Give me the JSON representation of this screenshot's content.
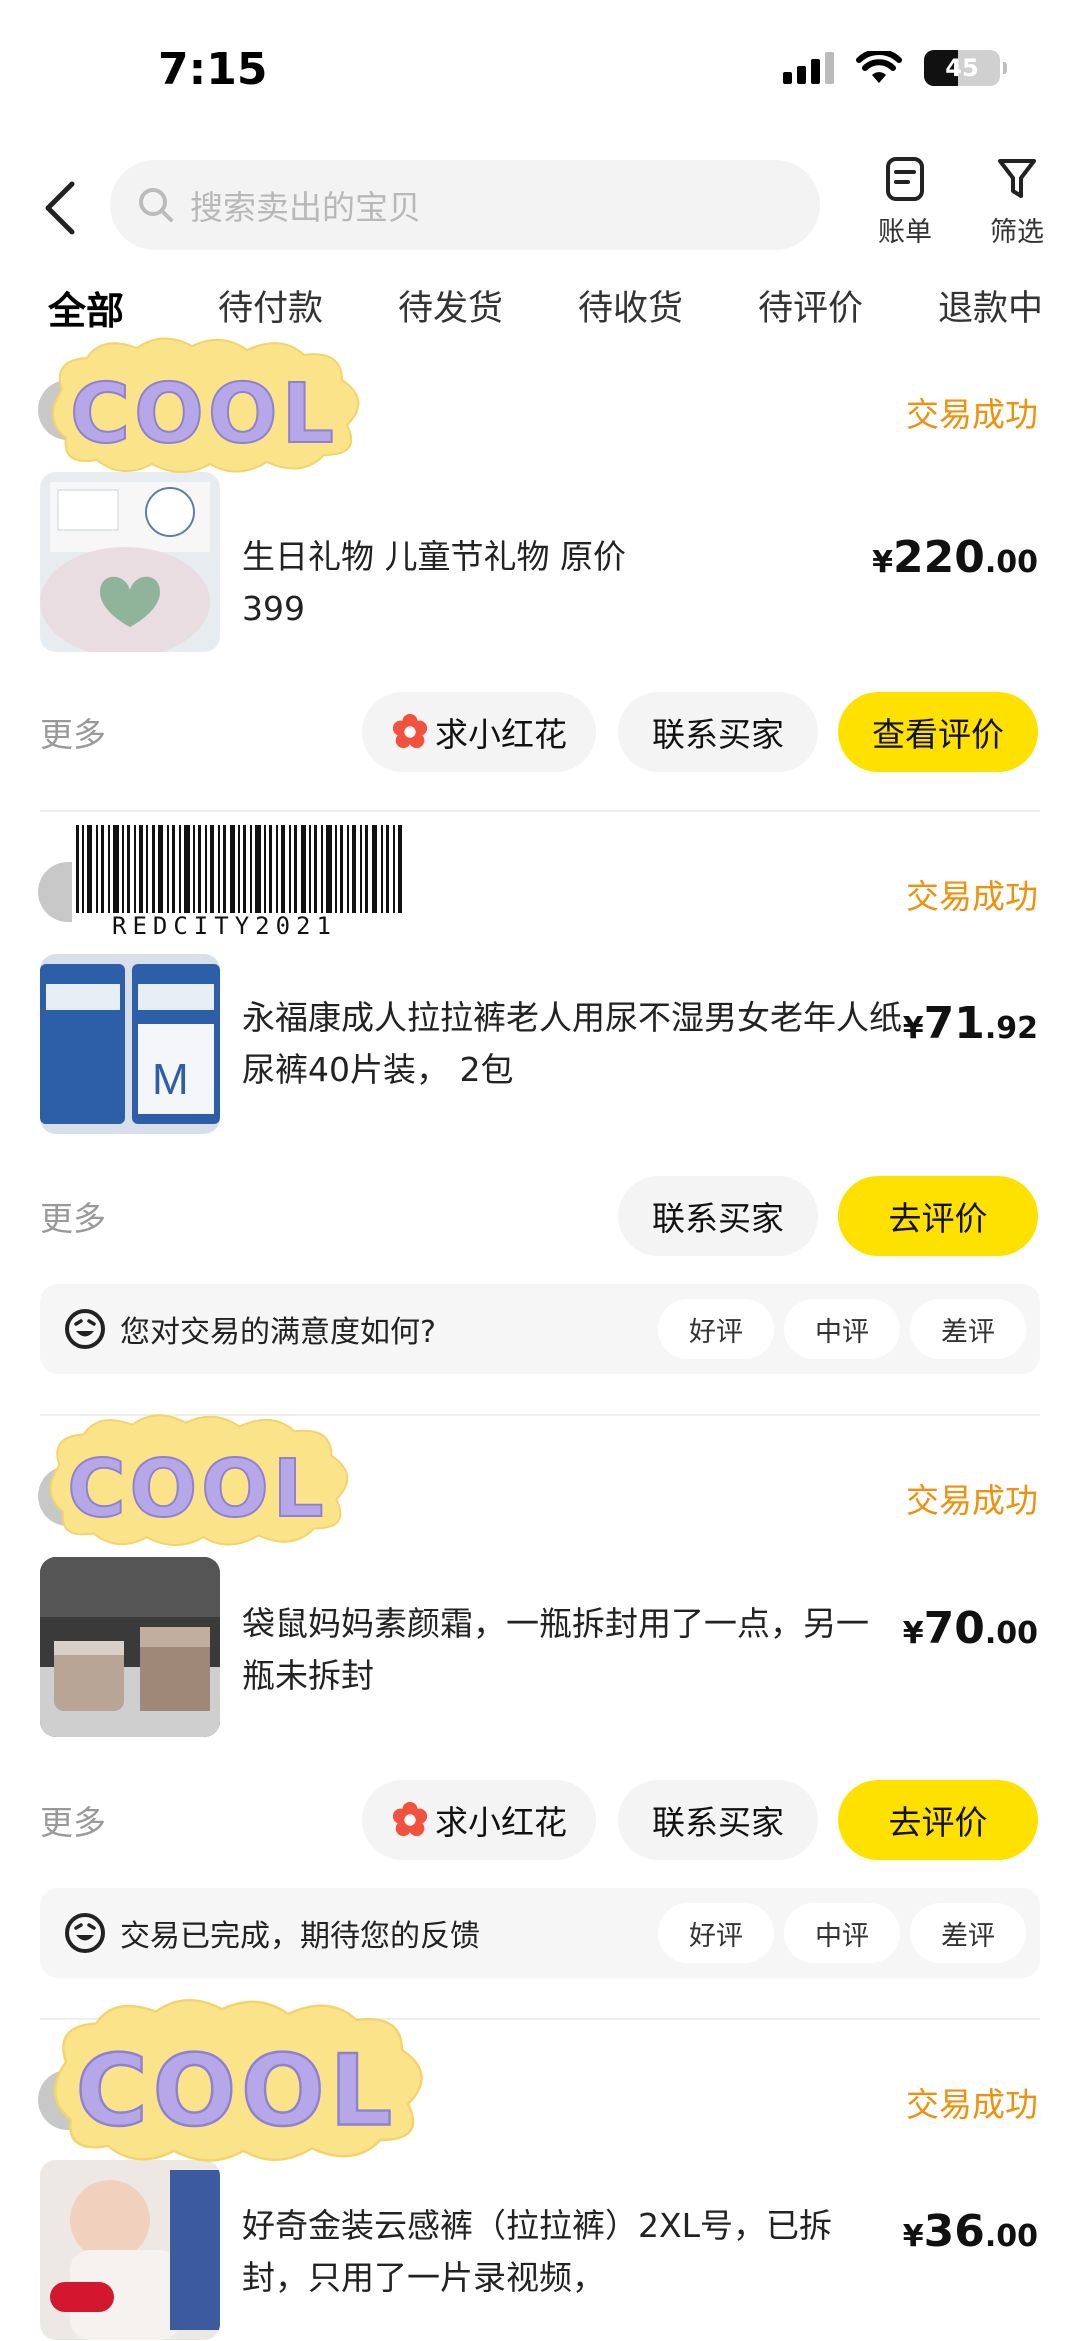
{
  "status_bar": {
    "time": "7:15",
    "battery": "45"
  },
  "search": {
    "placeholder": "搜索卖出的宝贝"
  },
  "top_actions": [
    {
      "label": "账单",
      "icon": "bill-icon"
    },
    {
      "label": "筛选",
      "icon": "filter-icon"
    }
  ],
  "tabs": [
    "全部",
    "待付款",
    "待发货",
    "待收货",
    "待评价",
    "退款中"
  ],
  "active_tab": 0,
  "sticker": {
    "cool_text": "COOL",
    "barcode_text": "REDCITY2021"
  },
  "orders": [
    {
      "status": "交易成功",
      "title": "生日礼物 儿童节礼物 原价399",
      "price_symbol": "¥",
      "price_int": "220",
      "price_dec": ".00",
      "more": "更多",
      "buttons": [
        "求小红花",
        "联系买家",
        "查看评价"
      ]
    },
    {
      "status": "交易成功",
      "title": "永福康成人拉拉裤老人用尿不湿男女老年人纸尿裤40片装， 2包",
      "price_symbol": "¥",
      "price_int": "71",
      "price_dec": ".92",
      "more": "更多",
      "buttons": [
        "联系买家",
        "去评价"
      ],
      "survey": {
        "question": "您对交易的满意度如何?",
        "options": [
          "好评",
          "中评",
          "差评"
        ]
      }
    },
    {
      "status": "交易成功",
      "title": "袋鼠妈妈素颜霜，一瓶拆封用了一点，另一瓶未拆封",
      "price_symbol": "¥",
      "price_int": "70",
      "price_dec": ".00",
      "more": "更多",
      "buttons": [
        "求小红花",
        "联系买家",
        "去评价"
      ],
      "survey": {
        "question": "交易已完成，期待您的反馈",
        "options": [
          "好评",
          "中评",
          "差评"
        ]
      }
    },
    {
      "status": "交易成功",
      "title": "好奇金装云感裤（拉拉裤）2XL号，已拆封，只用了一片录视频，",
      "price_symbol": "¥",
      "price_int": "36",
      "price_dec": ".00"
    }
  ],
  "colors": {
    "accent_yellow": "#ffe100",
    "status_orange": "#f0900c"
  }
}
